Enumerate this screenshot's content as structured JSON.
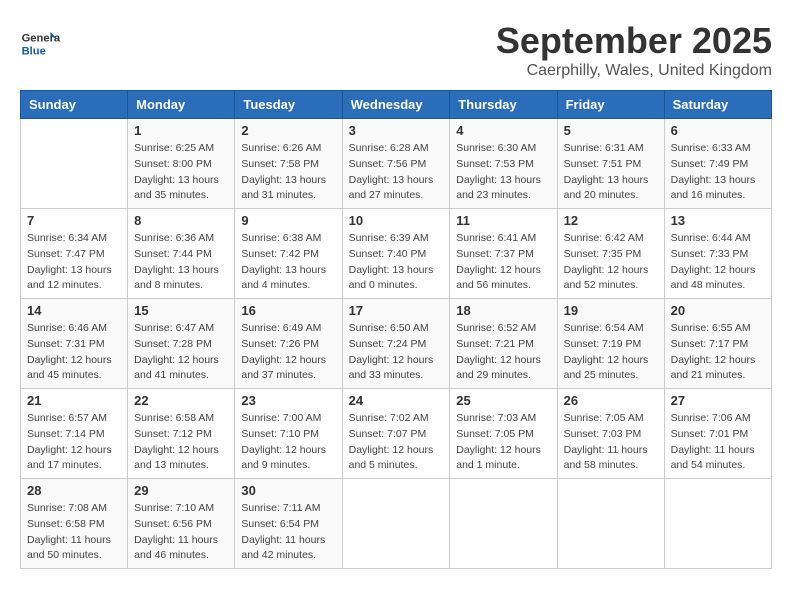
{
  "header": {
    "logo": {
      "general": "General",
      "blue": "Blue"
    },
    "title": "September 2025",
    "location": "Caerphilly, Wales, United Kingdom"
  },
  "weekdays": [
    "Sunday",
    "Monday",
    "Tuesday",
    "Wednesday",
    "Thursday",
    "Friday",
    "Saturday"
  ],
  "weeks": [
    [
      {
        "day": "",
        "sunrise": "",
        "sunset": "",
        "daylight": ""
      },
      {
        "day": "1",
        "sunrise": "Sunrise: 6:25 AM",
        "sunset": "Sunset: 8:00 PM",
        "daylight": "Daylight: 13 hours and 35 minutes."
      },
      {
        "day": "2",
        "sunrise": "Sunrise: 6:26 AM",
        "sunset": "Sunset: 7:58 PM",
        "daylight": "Daylight: 13 hours and 31 minutes."
      },
      {
        "day": "3",
        "sunrise": "Sunrise: 6:28 AM",
        "sunset": "Sunset: 7:56 PM",
        "daylight": "Daylight: 13 hours and 27 minutes."
      },
      {
        "day": "4",
        "sunrise": "Sunrise: 6:30 AM",
        "sunset": "Sunset: 7:53 PM",
        "daylight": "Daylight: 13 hours and 23 minutes."
      },
      {
        "day": "5",
        "sunrise": "Sunrise: 6:31 AM",
        "sunset": "Sunset: 7:51 PM",
        "daylight": "Daylight: 13 hours and 20 minutes."
      },
      {
        "day": "6",
        "sunrise": "Sunrise: 6:33 AM",
        "sunset": "Sunset: 7:49 PM",
        "daylight": "Daylight: 13 hours and 16 minutes."
      }
    ],
    [
      {
        "day": "7",
        "sunrise": "Sunrise: 6:34 AM",
        "sunset": "Sunset: 7:47 PM",
        "daylight": "Daylight: 13 hours and 12 minutes."
      },
      {
        "day": "8",
        "sunrise": "Sunrise: 6:36 AM",
        "sunset": "Sunset: 7:44 PM",
        "daylight": "Daylight: 13 hours and 8 minutes."
      },
      {
        "day": "9",
        "sunrise": "Sunrise: 6:38 AM",
        "sunset": "Sunset: 7:42 PM",
        "daylight": "Daylight: 13 hours and 4 minutes."
      },
      {
        "day": "10",
        "sunrise": "Sunrise: 6:39 AM",
        "sunset": "Sunset: 7:40 PM",
        "daylight": "Daylight: 13 hours and 0 minutes."
      },
      {
        "day": "11",
        "sunrise": "Sunrise: 6:41 AM",
        "sunset": "Sunset: 7:37 PM",
        "daylight": "Daylight: 12 hours and 56 minutes."
      },
      {
        "day": "12",
        "sunrise": "Sunrise: 6:42 AM",
        "sunset": "Sunset: 7:35 PM",
        "daylight": "Daylight: 12 hours and 52 minutes."
      },
      {
        "day": "13",
        "sunrise": "Sunrise: 6:44 AM",
        "sunset": "Sunset: 7:33 PM",
        "daylight": "Daylight: 12 hours and 48 minutes."
      }
    ],
    [
      {
        "day": "14",
        "sunrise": "Sunrise: 6:46 AM",
        "sunset": "Sunset: 7:31 PM",
        "daylight": "Daylight: 12 hours and 45 minutes."
      },
      {
        "day": "15",
        "sunrise": "Sunrise: 6:47 AM",
        "sunset": "Sunset: 7:28 PM",
        "daylight": "Daylight: 12 hours and 41 minutes."
      },
      {
        "day": "16",
        "sunrise": "Sunrise: 6:49 AM",
        "sunset": "Sunset: 7:26 PM",
        "daylight": "Daylight: 12 hours and 37 minutes."
      },
      {
        "day": "17",
        "sunrise": "Sunrise: 6:50 AM",
        "sunset": "Sunset: 7:24 PM",
        "daylight": "Daylight: 12 hours and 33 minutes."
      },
      {
        "day": "18",
        "sunrise": "Sunrise: 6:52 AM",
        "sunset": "Sunset: 7:21 PM",
        "daylight": "Daylight: 12 hours and 29 minutes."
      },
      {
        "day": "19",
        "sunrise": "Sunrise: 6:54 AM",
        "sunset": "Sunset: 7:19 PM",
        "daylight": "Daylight: 12 hours and 25 minutes."
      },
      {
        "day": "20",
        "sunrise": "Sunrise: 6:55 AM",
        "sunset": "Sunset: 7:17 PM",
        "daylight": "Daylight: 12 hours and 21 minutes."
      }
    ],
    [
      {
        "day": "21",
        "sunrise": "Sunrise: 6:57 AM",
        "sunset": "Sunset: 7:14 PM",
        "daylight": "Daylight: 12 hours and 17 minutes."
      },
      {
        "day": "22",
        "sunrise": "Sunrise: 6:58 AM",
        "sunset": "Sunset: 7:12 PM",
        "daylight": "Daylight: 12 hours and 13 minutes."
      },
      {
        "day": "23",
        "sunrise": "Sunrise: 7:00 AM",
        "sunset": "Sunset: 7:10 PM",
        "daylight": "Daylight: 12 hours and 9 minutes."
      },
      {
        "day": "24",
        "sunrise": "Sunrise: 7:02 AM",
        "sunset": "Sunset: 7:07 PM",
        "daylight": "Daylight: 12 hours and 5 minutes."
      },
      {
        "day": "25",
        "sunrise": "Sunrise: 7:03 AM",
        "sunset": "Sunset: 7:05 PM",
        "daylight": "Daylight: 12 hours and 1 minute."
      },
      {
        "day": "26",
        "sunrise": "Sunrise: 7:05 AM",
        "sunset": "Sunset: 7:03 PM",
        "daylight": "Daylight: 11 hours and 58 minutes."
      },
      {
        "day": "27",
        "sunrise": "Sunrise: 7:06 AM",
        "sunset": "Sunset: 7:01 PM",
        "daylight": "Daylight: 11 hours and 54 minutes."
      }
    ],
    [
      {
        "day": "28",
        "sunrise": "Sunrise: 7:08 AM",
        "sunset": "Sunset: 6:58 PM",
        "daylight": "Daylight: 11 hours and 50 minutes."
      },
      {
        "day": "29",
        "sunrise": "Sunrise: 7:10 AM",
        "sunset": "Sunset: 6:56 PM",
        "daylight": "Daylight: 11 hours and 46 minutes."
      },
      {
        "day": "30",
        "sunrise": "Sunrise: 7:11 AM",
        "sunset": "Sunset: 6:54 PM",
        "daylight": "Daylight: 11 hours and 42 minutes."
      },
      {
        "day": "",
        "sunrise": "",
        "sunset": "",
        "daylight": ""
      },
      {
        "day": "",
        "sunrise": "",
        "sunset": "",
        "daylight": ""
      },
      {
        "day": "",
        "sunrise": "",
        "sunset": "",
        "daylight": ""
      },
      {
        "day": "",
        "sunrise": "",
        "sunset": "",
        "daylight": ""
      }
    ]
  ]
}
